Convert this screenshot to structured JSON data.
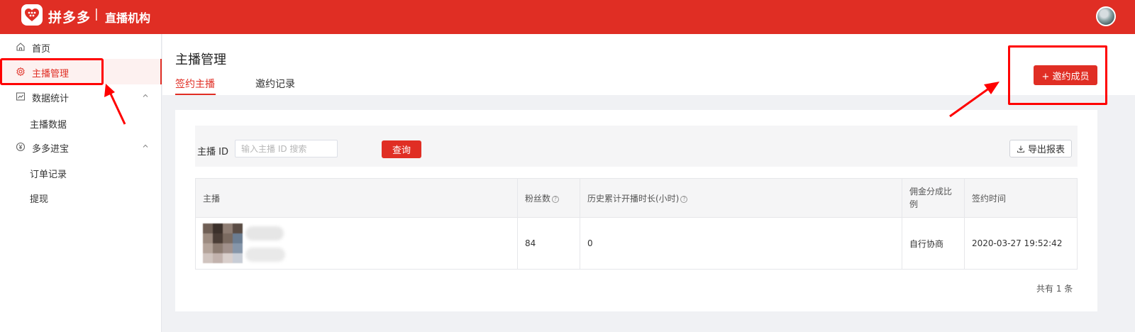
{
  "header": {
    "brand": "拼多多",
    "separator": "|",
    "subtitle": "直播机构"
  },
  "sidebar": {
    "items": [
      {
        "label": "首页"
      },
      {
        "label": "主播管理"
      },
      {
        "label": "数据统计"
      },
      {
        "label": "多多进宝"
      }
    ],
    "sub_items": [
      {
        "label": "主播数据"
      },
      {
        "label": "订单记录"
      },
      {
        "label": "提现"
      }
    ]
  },
  "main": {
    "title": "主播管理",
    "tabs": [
      {
        "label": "签约主播"
      },
      {
        "label": "邀约记录"
      }
    ],
    "invite_button": "+ 邀约成员"
  },
  "search": {
    "label": "主播 ID",
    "placeholder": "输入主播 ID 搜索",
    "query_button": "查询",
    "export_button": "导出报表"
  },
  "table": {
    "headers": [
      "主播",
      "粉丝数",
      "历史累计开播时长(小时)",
      "佣金分成比例",
      "签约时间"
    ],
    "rows": [
      {
        "fans": "84",
        "hours": "0",
        "commission": "自行协商",
        "signed_time": "2020-03-27 19:52:42"
      }
    ],
    "total": "共有 1 条"
  },
  "colors": {
    "brand_red": "#e02e24",
    "annotation_red": "#ff0000"
  }
}
